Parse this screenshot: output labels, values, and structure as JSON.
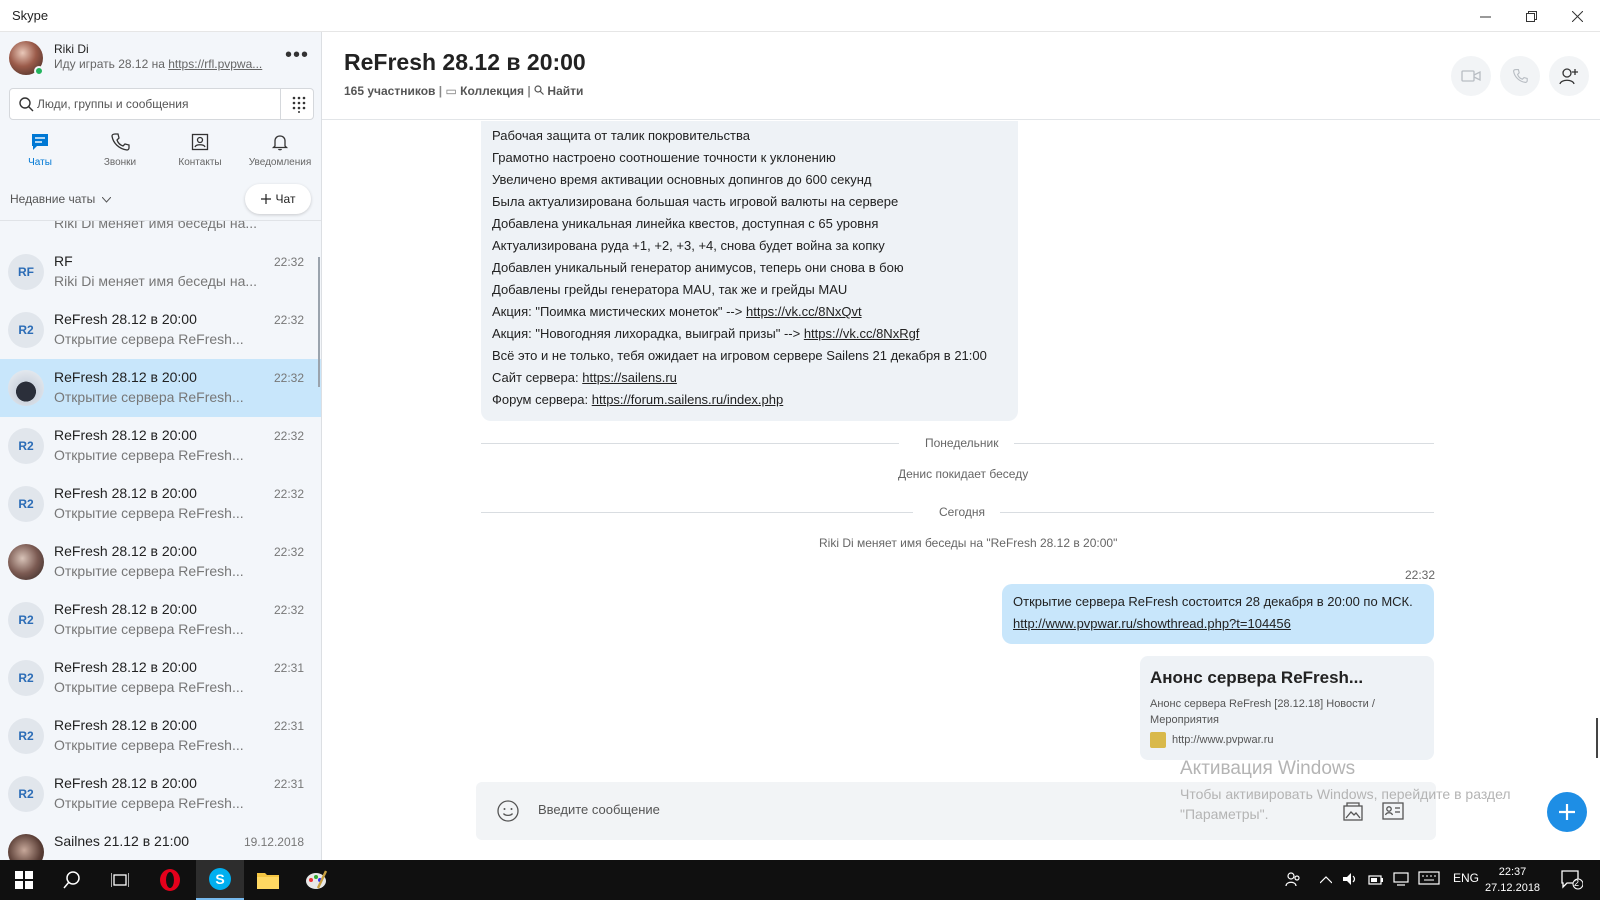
{
  "window": {
    "title": "Skype"
  },
  "profile": {
    "name": "Riki Di",
    "status_prefix": "Иду играть 28.12 на ",
    "status_link": "https://rfl.pvpwa..."
  },
  "search": {
    "placeholder": "Люди, группы и сообщения"
  },
  "nav": [
    {
      "label": "Чаты",
      "icon": "chat-icon",
      "active": true
    },
    {
      "label": "Звонки",
      "icon": "phone-icon"
    },
    {
      "label": "Контакты",
      "icon": "contacts-icon"
    },
    {
      "label": "Уведомления",
      "icon": "bell-icon"
    }
  ],
  "recent": {
    "header": "Недавние чаты",
    "new_chat": "Чат"
  },
  "chats": [
    {
      "title": "",
      "preview": "Riki Di меняет имя беседы на...",
      "time": "",
      "avatar": ""
    },
    {
      "title": "RF",
      "preview": "Riki Di меняет имя беседы на...",
      "time": "22:32",
      "avatar": "RF"
    },
    {
      "title": "ReFresh 28.12 в 20:00",
      "preview": "Открытие сервера ReFresh...",
      "time": "22:32",
      "avatar": "R2"
    },
    {
      "title": "ReFresh 28.12 в 20:00",
      "preview": "Открытие сервера ReFresh...",
      "time": "22:32",
      "avatar": ""
    },
    {
      "title": "ReFresh 28.12 в 20:00",
      "preview": "Открытие сервера ReFresh...",
      "time": "22:32",
      "avatar": "R2"
    },
    {
      "title": "ReFresh 28.12 в 20:00",
      "preview": "Открытие сервера ReFresh...",
      "time": "22:32",
      "avatar": "R2"
    },
    {
      "title": "ReFresh 28.12 в 20:00",
      "preview": "Открытие сервера ReFresh...",
      "time": "22:32",
      "avatar": ""
    },
    {
      "title": "ReFresh 28.12 в 20:00",
      "preview": "Открытие сервера ReFresh...",
      "time": "22:32",
      "avatar": "R2"
    },
    {
      "title": "ReFresh 28.12 в 20:00",
      "preview": "Открытие сервера ReFresh...",
      "time": "22:31",
      "avatar": "R2"
    },
    {
      "title": "ReFresh 28.12 в 20:00",
      "preview": "Открытие сервера ReFresh...",
      "time": "22:31",
      "avatar": "R2"
    },
    {
      "title": "ReFresh 28.12 в 20:00",
      "preview": "Открытие сервера ReFresh...",
      "time": "22:31",
      "avatar": "R2"
    },
    {
      "title": "Sailnes 21.12 в 21:00",
      "preview": "",
      "time": "19.12.2018",
      "avatar": ""
    }
  ],
  "conversation": {
    "title": "ReFresh 28.12 в 20:00",
    "participants": "165 участников",
    "collection": "Коллекция",
    "find": "Найти"
  },
  "incoming": {
    "lines": [
      {
        "text": "Рабочая защита от талик покровительства"
      },
      {
        "text": "Грамотно настроено соотношение точности к уклонению"
      },
      {
        "text": "Увеличено время активации основных допингов до 600 секунд"
      },
      {
        "text": "Была актуализирована большая часть игровой валюты на сервере"
      },
      {
        "text": "Добавлена уникальная линейка квестов, доступная с 65 уровня"
      },
      {
        "text": "Актуализирована руда +1, +2, +3, +4, снова будет война за копку"
      },
      {
        "text": "Добавлен уникальный генератор анимусов, теперь они снова в бою"
      },
      {
        "text": "Добавлены грейды генератора MAU, так же и грейды MAU"
      },
      {
        "text": "Акция: \"Поимка мистических монеток\" --> ",
        "link": "https://vk.cc/8NxQvt"
      },
      {
        "text": "Акция: \"Новогодняя лихорадка, выиграй призы\" --> ",
        "link": "https://vk.cc/8NxRgf"
      },
      {
        "text": "Всё это и не только, тебя ожидает на игровом сервере Sailens 21 декабря в 21:00"
      },
      {
        "text": "Сайт сервера: ",
        "link": "https://sailens.ru"
      },
      {
        "text": "Форум сервера: ",
        "link": "https://forum.sailens.ru/index.php"
      }
    ]
  },
  "events": {
    "monday": "Понедельник",
    "left": "Денис покидает беседу",
    "today": "Сегодня",
    "rename": "Riki Di меняет имя беседы на \"ReFresh 28.12 в 20:00\""
  },
  "outgoing": {
    "time": "22:32",
    "text": "Открытие сервера ReFresh состоится 28 декабря в 20:00 по МСК.",
    "link": "http://www.pvpwar.ru/showthread.php?t=104456"
  },
  "link_preview": {
    "title": "Анонс сервера ReFresh...",
    "description": "Анонс сервера ReFresh [28.12.18] Новости / Мероприятия",
    "url": "http://www.pvpwar.ru"
  },
  "composer": {
    "placeholder": "Введите сообщение"
  },
  "watermark": {
    "line1": "Активация Windows",
    "line2": "Чтобы активировать Windows, перейдите в раздел \"Параметры\"."
  },
  "taskbar": {
    "lang": "ENG",
    "time": "22:37",
    "date": "27.12.2018",
    "notifications": "2"
  },
  "colors": {
    "accent": "#0078d4",
    "selected": "#c8e6fb",
    "sidebar": "#f3f6fa",
    "plus": "#1e8ee5"
  }
}
